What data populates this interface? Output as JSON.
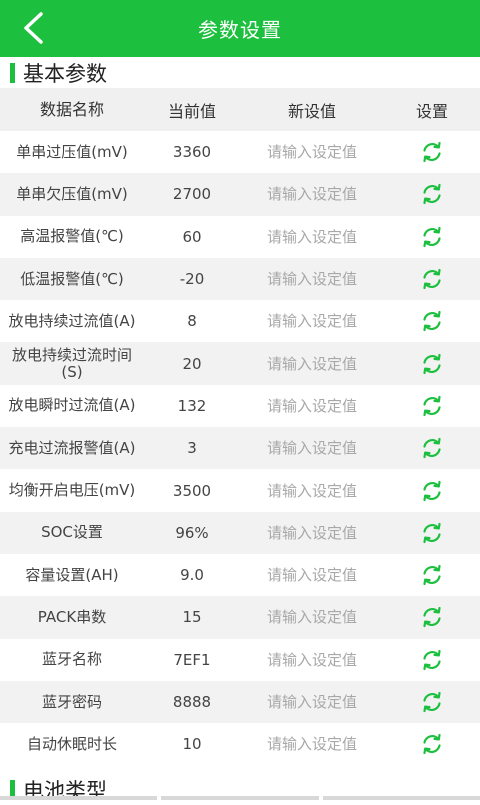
{
  "header": {
    "title": "参数设置",
    "back_icon": "chevron-left-icon"
  },
  "section_basic": {
    "title": "基本参数"
  },
  "table": {
    "headers": [
      "数据名称",
      "当前值",
      "新设值",
      "设置"
    ],
    "placeholder": "请输入设定值",
    "rows": [
      {
        "name": "单串过压值(mV)",
        "value": "3360"
      },
      {
        "name": "单串欠压值(mV)",
        "value": "2700"
      },
      {
        "name": "高温报警值(℃)",
        "value": "60"
      },
      {
        "name": "低温报警值(℃)",
        "value": "-20"
      },
      {
        "name": "放电持续过流值(A)",
        "value": "8"
      },
      {
        "name": "放电持续过流时间(S)",
        "value": "20"
      },
      {
        "name": "放电瞬时过流值(A)",
        "value": "132"
      },
      {
        "name": "充电过流报警值(A)",
        "value": "3"
      },
      {
        "name": "均衡开启电压(mV)",
        "value": "3500"
      },
      {
        "name": "SOC设置",
        "value": "96%"
      },
      {
        "name": "容量设置(AH)",
        "value": "9.0"
      },
      {
        "name": "PACK串数",
        "value": "15"
      },
      {
        "name": "蓝牙名称",
        "value": "7EF1"
      },
      {
        "name": "蓝牙密码",
        "value": "8888"
      },
      {
        "name": "自动休眠时长",
        "value": "10"
      }
    ]
  },
  "section_battery": {
    "title": "电池类型"
  },
  "colors": {
    "accent": "#1dbf3e",
    "row_alt": "#f2f2f2"
  }
}
